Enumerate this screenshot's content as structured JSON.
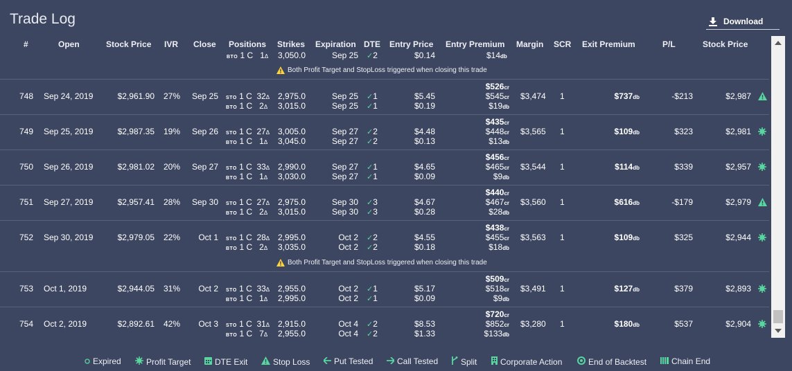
{
  "title": "Trade Log",
  "download_label": "Download",
  "headers": [
    "#",
    "Open",
    "Stock Price",
    "IVR",
    "Close",
    "Positions",
    "Strikes",
    "Expiration",
    "DTE",
    "Entry Price",
    "Entry Premium",
    "Margin",
    "SCR",
    "Exit Premium",
    "P/L",
    "Stock Price"
  ],
  "partial_row": {
    "pos2_tag": "BTO",
    "pos2_qty": "1 C",
    "pos2_delta": "1",
    "strike2": "3,050.0",
    "exp2": "Sep 25",
    "dte2": "2",
    "entry2": "$0.14",
    "prem2": "$14",
    "prem2_suffix": "db",
    "note": "Both Profit Target and StopLoss triggered when closing this trade"
  },
  "rows": [
    {
      "id": "748",
      "open": "Sep 24, 2019",
      "price": "$2,961.90",
      "ivr": "27%",
      "close": "Sep 25",
      "q1": "1 C",
      "d1": "32",
      "q2": "1 C",
      "d2": "2",
      "s1": "2,975.0",
      "s2": "3,015.0",
      "e1": "Sep 25",
      "e2": "Sep 25",
      "t1": "1",
      "t2": "1",
      "ep1": "$5.45",
      "ep2": "$0.19",
      "net": "$526",
      "net_s": "cr",
      "p1": "$545",
      "p1_s": "cr",
      "p2": "$19",
      "p2_s": "db",
      "margin": "$3,474",
      "scr": "1",
      "exit": "$737",
      "exit_s": "db",
      "pl": "-$213",
      "sp": "$2,987",
      "status": "stop-loss"
    },
    {
      "id": "749",
      "open": "Sep 25, 2019",
      "price": "$2,987.35",
      "ivr": "19%",
      "close": "Sep 26",
      "q1": "1 C",
      "d1": "27",
      "q2": "1 C",
      "d2": "1",
      "s1": "3,005.0",
      "s2": "3,045.0",
      "e1": "Sep 27",
      "e2": "Sep 27",
      "t1": "2",
      "t2": "2",
      "ep1": "$4.48",
      "ep2": "$0.13",
      "net": "$435",
      "net_s": "cr",
      "p1": "$448",
      "p1_s": "cr",
      "p2": "$13",
      "p2_s": "db",
      "margin": "$3,565",
      "scr": "1",
      "exit": "$109",
      "exit_s": "db",
      "pl": "$323",
      "sp": "$2,981",
      "status": "profit-target"
    },
    {
      "id": "750",
      "open": "Sep 26, 2019",
      "price": "$2,981.02",
      "ivr": "20%",
      "close": "Sep 27",
      "q1": "1 C",
      "d1": "33",
      "q2": "1 C",
      "d2": "1",
      "s1": "2,990.0",
      "s2": "3,030.0",
      "e1": "Sep 27",
      "e2": "Sep 27",
      "t1": "1",
      "t2": "1",
      "ep1": "$4.65",
      "ep2": "$0.09",
      "net": "$456",
      "net_s": "cr",
      "p1": "$465",
      "p1_s": "cr",
      "p2": "$9",
      "p2_s": "db",
      "margin": "$3,544",
      "scr": "1",
      "exit": "$114",
      "exit_s": "db",
      "pl": "$339",
      "sp": "$2,957",
      "status": "profit-target"
    },
    {
      "id": "751",
      "open": "Sep 27, 2019",
      "price": "$2,957.41",
      "ivr": "28%",
      "close": "Sep 30",
      "q1": "1 C",
      "d1": "27",
      "q2": "1 C",
      "d2": "2",
      "s1": "2,975.0",
      "s2": "3,015.0",
      "e1": "Sep 30",
      "e2": "Sep 30",
      "t1": "3",
      "t2": "3",
      "ep1": "$4.67",
      "ep2": "$0.28",
      "net": "$440",
      "net_s": "cr",
      "p1": "$467",
      "p1_s": "cr",
      "p2": "$28",
      "p2_s": "db",
      "margin": "$3,560",
      "scr": "1",
      "exit": "$616",
      "exit_s": "db",
      "pl": "-$179",
      "sp": "$2,979",
      "status": "stop-loss"
    },
    {
      "id": "752",
      "open": "Sep 30, 2019",
      "price": "$2,979.05",
      "ivr": "22%",
      "close": "Oct 1",
      "q1": "1 C",
      "d1": "28",
      "q2": "1 C",
      "d2": "2",
      "s1": "2,995.0",
      "s2": "3,035.0",
      "e1": "Oct 2",
      "e2": "Oct 2",
      "t1": "2",
      "t2": "2",
      "ep1": "$4.55",
      "ep2": "$0.18",
      "net": "$438",
      "net_s": "cr",
      "p1": "$455",
      "p1_s": "cr",
      "p2": "$18",
      "p2_s": "db",
      "margin": "$3,563",
      "scr": "1",
      "exit": "$109",
      "exit_s": "db",
      "pl": "$325",
      "sp": "$2,944",
      "status": "profit-target",
      "note": "Both Profit Target and StopLoss triggered when closing this trade"
    },
    {
      "id": "753",
      "open": "Oct 1, 2019",
      "price": "$2,944.05",
      "ivr": "31%",
      "close": "Oct 2",
      "q1": "1 C",
      "d1": "33",
      "q2": "1 C",
      "d2": "1",
      "s1": "2,955.0",
      "s2": "2,995.0",
      "e1": "Oct 2",
      "e2": "Oct 2",
      "t1": "1",
      "t2": "1",
      "ep1": "$5.17",
      "ep2": "$0.09",
      "net": "$509",
      "net_s": "cr",
      "p1": "$518",
      "p1_s": "cr",
      "p2": "$9",
      "p2_s": "db",
      "margin": "$3,491",
      "scr": "1",
      "exit": "$127",
      "exit_s": "db",
      "pl": "$379",
      "sp": "$2,893",
      "status": "profit-target"
    },
    {
      "id": "754",
      "open": "Oct 2, 2019",
      "price": "$2,892.61",
      "ivr": "42%",
      "close": "Oct 3",
      "q1": "1 C",
      "d1": "31",
      "q2": "1 C",
      "d2": "7",
      "s1": "2,915.0",
      "s2": "2,955.0",
      "e1": "Oct 4",
      "e2": "Oct 4",
      "t1": "2",
      "t2": "2",
      "ep1": "$8.53",
      "ep2": "$1.33",
      "net": "$720",
      "net_s": "cr",
      "p1": "$852",
      "p1_s": "cr",
      "p2": "$133",
      "p2_s": "db",
      "margin": "$3,280",
      "scr": "1",
      "exit": "$180",
      "exit_s": "db",
      "pl": "$537",
      "sp": "$2,904",
      "status": "profit-target"
    }
  ],
  "tags": {
    "sto": "STO",
    "bto": "BTO",
    "delta": "Δ"
  },
  "legend": [
    "Expired",
    "Profit Target",
    "DTE Exit",
    "Stop Loss",
    "Put Tested",
    "Call Tested",
    "Split",
    "Corporate Action",
    "End of Backtest",
    "Chain End"
  ],
  "colors": {
    "background": "#3d4660",
    "accent": "#58d6a0",
    "warning": "#ffd43b",
    "separator": "#5a6279"
  }
}
